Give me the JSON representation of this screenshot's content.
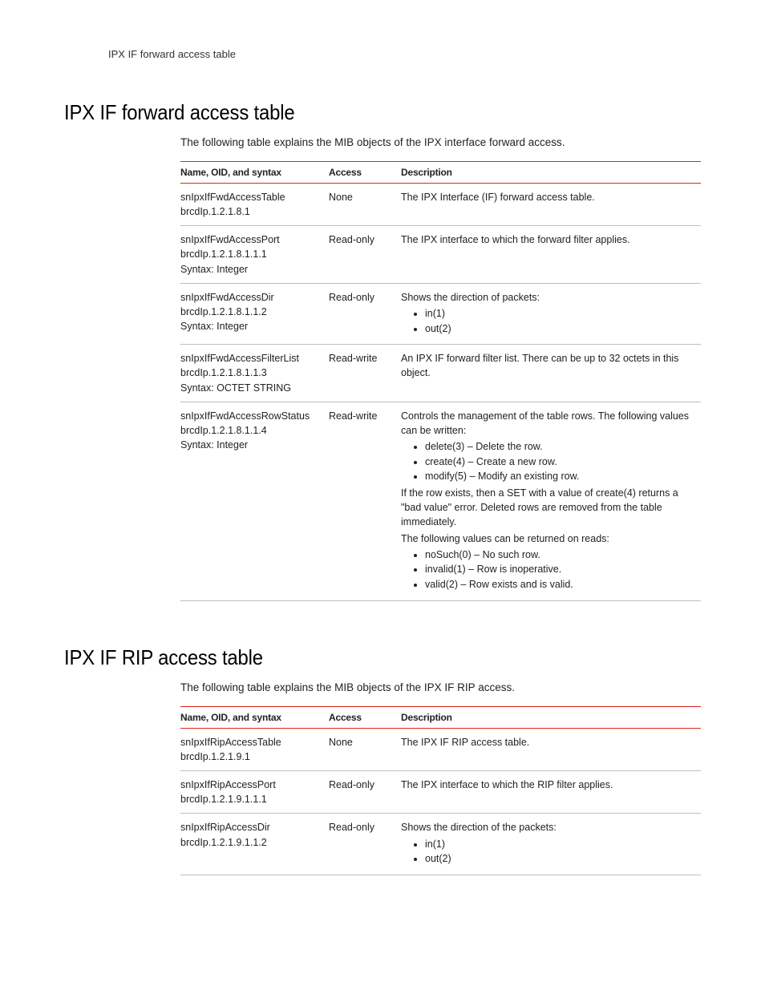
{
  "running_head": "IPX IF forward access table",
  "sections": [
    {
      "heading": "IPX IF forward access table",
      "intro": "The following table explains the MIB objects of the IPX interface forward access.",
      "columns": {
        "c1": "Name, OID, and syntax",
        "c2": "Access",
        "c3": "Description"
      },
      "rows": [
        {
          "name_lines": [
            "snIpxIfFwdAccessTable",
            "brcdIp.1.2.1.8.1"
          ],
          "access": "None",
          "desc": [
            {
              "type": "text",
              "value": "The IPX Interface (IF) forward access table."
            }
          ]
        },
        {
          "name_lines": [
            "snIpxIfFwdAccessPort",
            "brcdIp.1.2.1.8.1.1.1",
            "Syntax: Integer"
          ],
          "access": "Read-only",
          "desc": [
            {
              "type": "text",
              "value": "The IPX interface to which the forward filter applies."
            }
          ]
        },
        {
          "name_lines": [
            "snIpxIfFwdAccessDir",
            "brcdIp.1.2.1.8.1.1.2",
            "Syntax: Integer"
          ],
          "access": "Read-only",
          "desc": [
            {
              "type": "text",
              "value": "Shows the direction of packets:"
            },
            {
              "type": "list",
              "items": [
                "in(1)",
                "out(2)"
              ]
            }
          ]
        },
        {
          "name_lines": [
            "snIpxIfFwdAccessFilterList",
            "brcdIp.1.2.1.8.1.1.3",
            "Syntax: OCTET STRING"
          ],
          "access": "Read-write",
          "desc": [
            {
              "type": "text",
              "value": "An IPX IF forward filter list. There can be up to 32 octets in this object."
            }
          ]
        },
        {
          "name_lines": [
            "snIpxIfFwdAccessRowStatus",
            "brcdIp.1.2.1.8.1.1.4",
            "Syntax: Integer"
          ],
          "access": "Read-write",
          "desc": [
            {
              "type": "text",
              "value": "Controls the management of the table rows. The following values can be written:"
            },
            {
              "type": "list",
              "items": [
                "delete(3) – Delete the row.",
                "create(4) – Create a new row.",
                "modify(5) – Modify an existing row."
              ]
            },
            {
              "type": "text",
              "value": "If the row exists, then a SET with a value of create(4) returns a \"bad value\" error. Deleted rows are removed from the table immediately."
            },
            {
              "type": "text",
              "value": "The following values can be returned on reads:"
            },
            {
              "type": "list",
              "items": [
                "noSuch(0) – No such row.",
                "invalid(1) – Row is inoperative.",
                "valid(2) – Row exists and is valid."
              ]
            }
          ]
        }
      ]
    },
    {
      "heading": "IPX IF RIP access table",
      "intro": "The following table explains the MIB objects of the IPX IF RIP access.",
      "columns": {
        "c1": "Name, OID, and syntax",
        "c2": "Access",
        "c3": "Description"
      },
      "rows": [
        {
          "name_lines": [
            "snIpxIfRipAccessTable",
            "brcdIp.1.2.1.9.1"
          ],
          "access": "None",
          "desc": [
            {
              "type": "text",
              "value": "The IPX IF RIP access table."
            }
          ]
        },
        {
          "name_lines": [
            "snIpxIfRipAccessPort",
            "brcdIp.1.2.1.9.1.1.1"
          ],
          "access": "Read-only",
          "desc": [
            {
              "type": "text",
              "value": "The IPX interface to which the RIP filter applies."
            }
          ]
        },
        {
          "name_lines": [
            "snIpxIfRipAccessDir",
            "brcdIp.1.2.1.9.1.1.2"
          ],
          "access": "Read-only",
          "desc": [
            {
              "type": "text",
              "value": "Shows the direction of the packets:"
            },
            {
              "type": "list",
              "items": [
                "in(1)",
                "out(2)"
              ]
            }
          ]
        }
      ]
    }
  ]
}
